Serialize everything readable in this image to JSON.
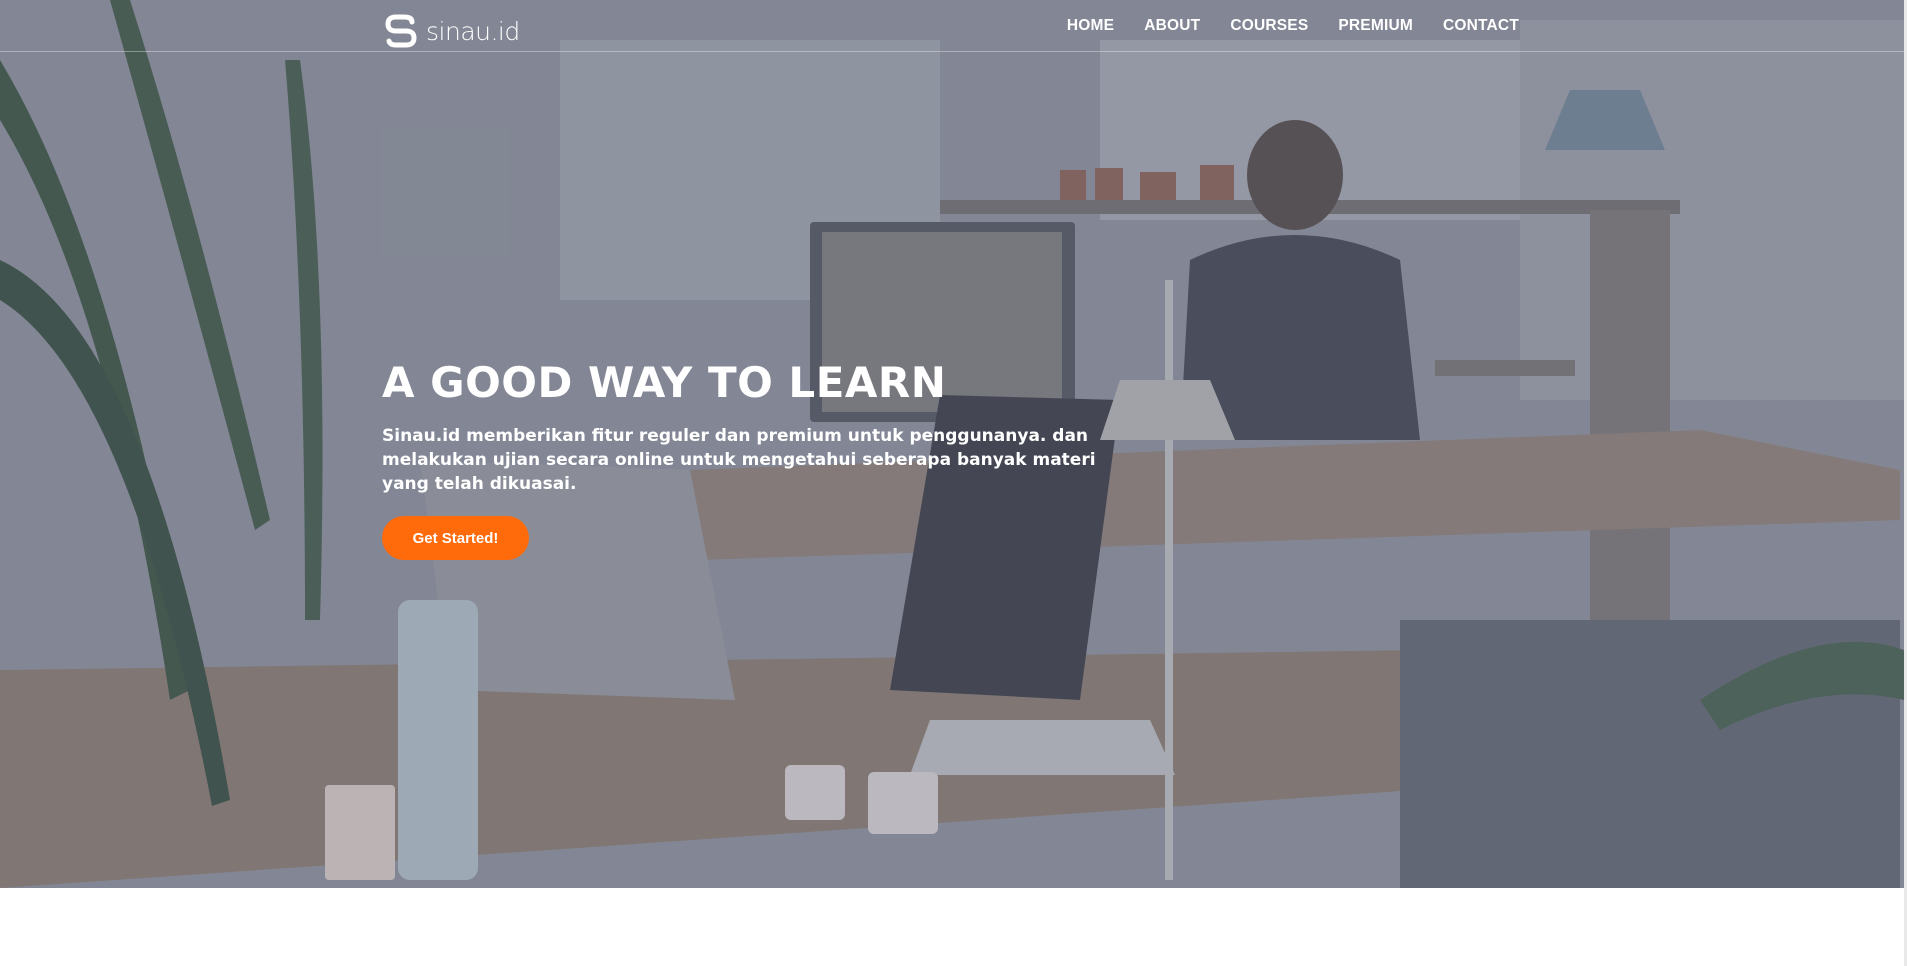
{
  "brand": {
    "logo_text": "sinau.id",
    "icon": "sinau-s-logo-icon"
  },
  "nav": {
    "items": [
      {
        "label": "HOME"
      },
      {
        "label": "ABOUT"
      },
      {
        "label": "COURSES"
      },
      {
        "label": "PREMIUM"
      },
      {
        "label": "CONTACT"
      }
    ]
  },
  "hero": {
    "title": "A GOOD WAY TO LEARN",
    "subtitle": "Sinau.id memberikan fitur reguler dan premium untuk penggunanya. dan melakukan ujian secara online untuk mengetahui seberapa banyak materi yang telah dikuasai.",
    "cta_label": "Get Started!",
    "background": "office-workspace-photo"
  },
  "colors": {
    "accent": "#ff6a0a",
    "overlay": "#6e7487",
    "text": "#ffffff"
  }
}
